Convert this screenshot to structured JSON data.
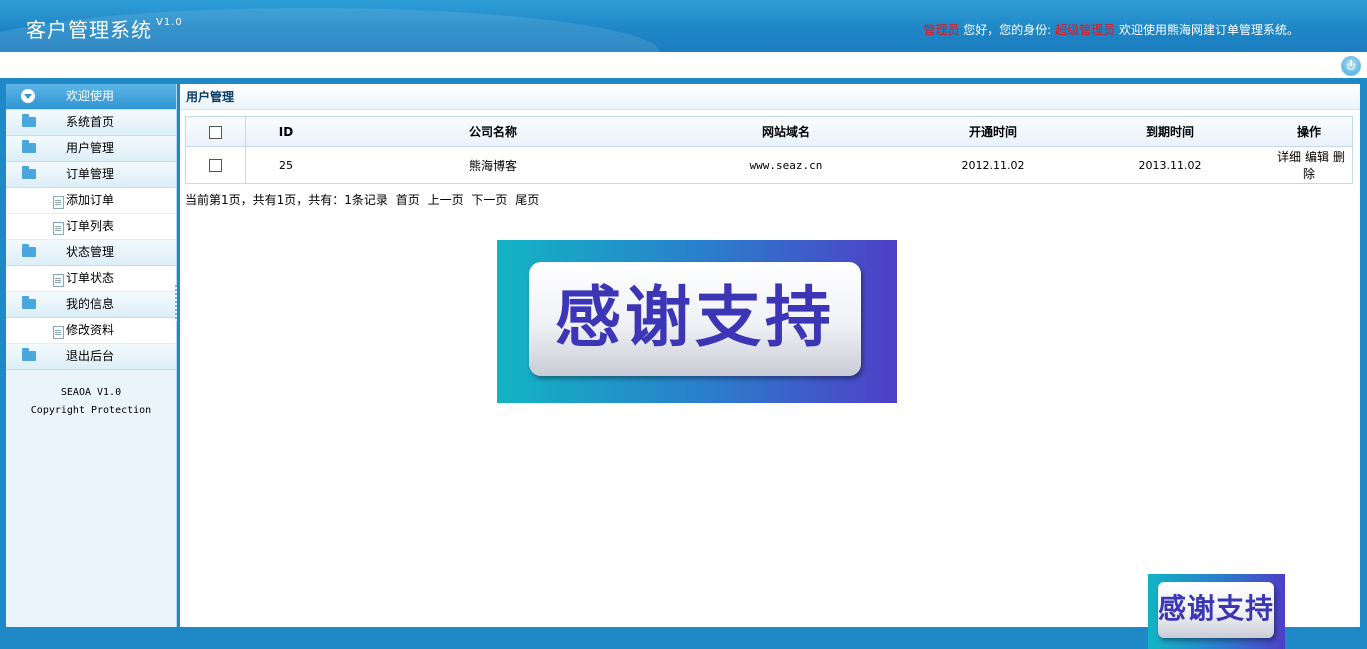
{
  "header": {
    "title": "客户管理系统",
    "version": "V1.0",
    "user_name": "管理员",
    "greeting": " 您好，您的身份: ",
    "role": "超级管理员",
    "welcome": " 欢迎使用熊海网建订单管理系统。"
  },
  "sidebar": {
    "items": [
      {
        "label": "欢迎使用",
        "type": "header-active"
      },
      {
        "label": "系统首页",
        "type": "group"
      },
      {
        "label": "用户管理",
        "type": "group"
      },
      {
        "label": "订单管理",
        "type": "group"
      },
      {
        "label": "添加订单",
        "type": "sub"
      },
      {
        "label": "订单列表",
        "type": "sub"
      },
      {
        "label": "状态管理",
        "type": "group"
      },
      {
        "label": "订单状态",
        "type": "sub"
      },
      {
        "label": "我的信息",
        "type": "group"
      },
      {
        "label": "修改资料",
        "type": "sub"
      },
      {
        "label": "退出后台",
        "type": "group"
      }
    ],
    "copyright_line1": "SEAOA V1.0",
    "copyright_line2": "Copyright Protection"
  },
  "main": {
    "section_title": "用户管理",
    "table": {
      "headers": [
        "ID",
        "公司名称",
        "网站域名",
        "开通时间",
        "到期时间",
        "操作"
      ],
      "rows": [
        {
          "id": "25",
          "company": "熊海博客",
          "domain": "www.seaz.cn",
          "open_date": "2012.11.02",
          "expire_date": "2013.11.02"
        }
      ],
      "actions": [
        "详细",
        "编辑",
        "删除"
      ]
    },
    "pager": {
      "summary": "当前第1页，共有1页，共有：1条记录",
      "first": "首页",
      "prev": "上一页",
      "next": "下一页",
      "last": "尾页"
    },
    "banner_text": "感谢支持"
  },
  "colors": {
    "header_blue": "#1f86c6",
    "highlight_red": "#e8141b",
    "sidebar_bg": "#eaf4fb"
  }
}
